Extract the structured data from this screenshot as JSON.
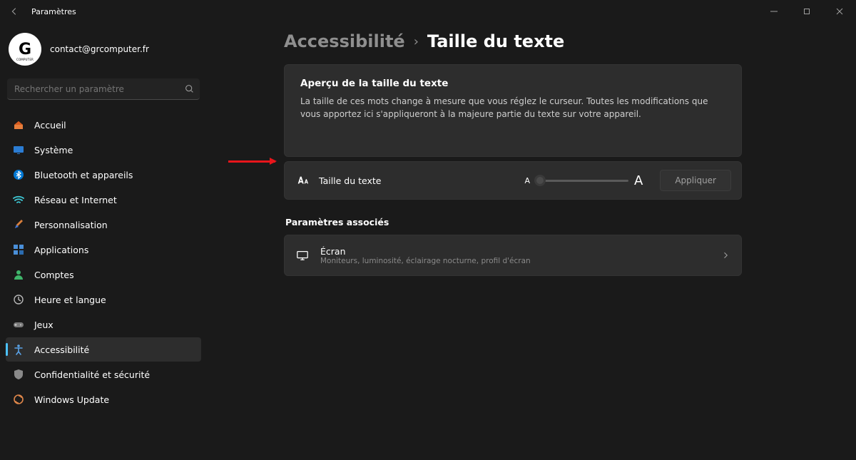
{
  "window": {
    "title": "Paramètres"
  },
  "profile": {
    "email": "contact@grcomputer.fr",
    "avatar_initials": "G",
    "avatar_sub": "COMPUTER"
  },
  "search": {
    "placeholder": "Rechercher un paramètre"
  },
  "sidebar": {
    "items": [
      {
        "label": "Accueil"
      },
      {
        "label": "Système"
      },
      {
        "label": "Bluetooth et appareils"
      },
      {
        "label": "Réseau et Internet"
      },
      {
        "label": "Personnalisation"
      },
      {
        "label": "Applications"
      },
      {
        "label": "Comptes"
      },
      {
        "label": "Heure et langue"
      },
      {
        "label": "Jeux"
      },
      {
        "label": "Accessibilité"
      },
      {
        "label": "Confidentialité et sécurité"
      },
      {
        "label": "Windows Update"
      }
    ],
    "selected_index": 9
  },
  "breadcrumb": {
    "prev": "Accessibilité",
    "sep": "›",
    "current": "Taille du texte"
  },
  "preview": {
    "title": "Aperçu de la taille du texte",
    "body": "La taille de ces mots change à mesure que vous réglez le curseur. Toutes les modifications que vous apportez ici s'appliqueront à la majeure partie du texte sur votre appareil."
  },
  "text_size": {
    "label": "Taille du texte",
    "scale_small": "A",
    "scale_large": "A",
    "apply": "Appliquer",
    "value_percent": 0
  },
  "related": {
    "heading": "Paramètres associés",
    "items": [
      {
        "title": "Écran",
        "desc": "Moniteurs, luminosité, éclairage nocturne, profil d'écran"
      }
    ]
  }
}
